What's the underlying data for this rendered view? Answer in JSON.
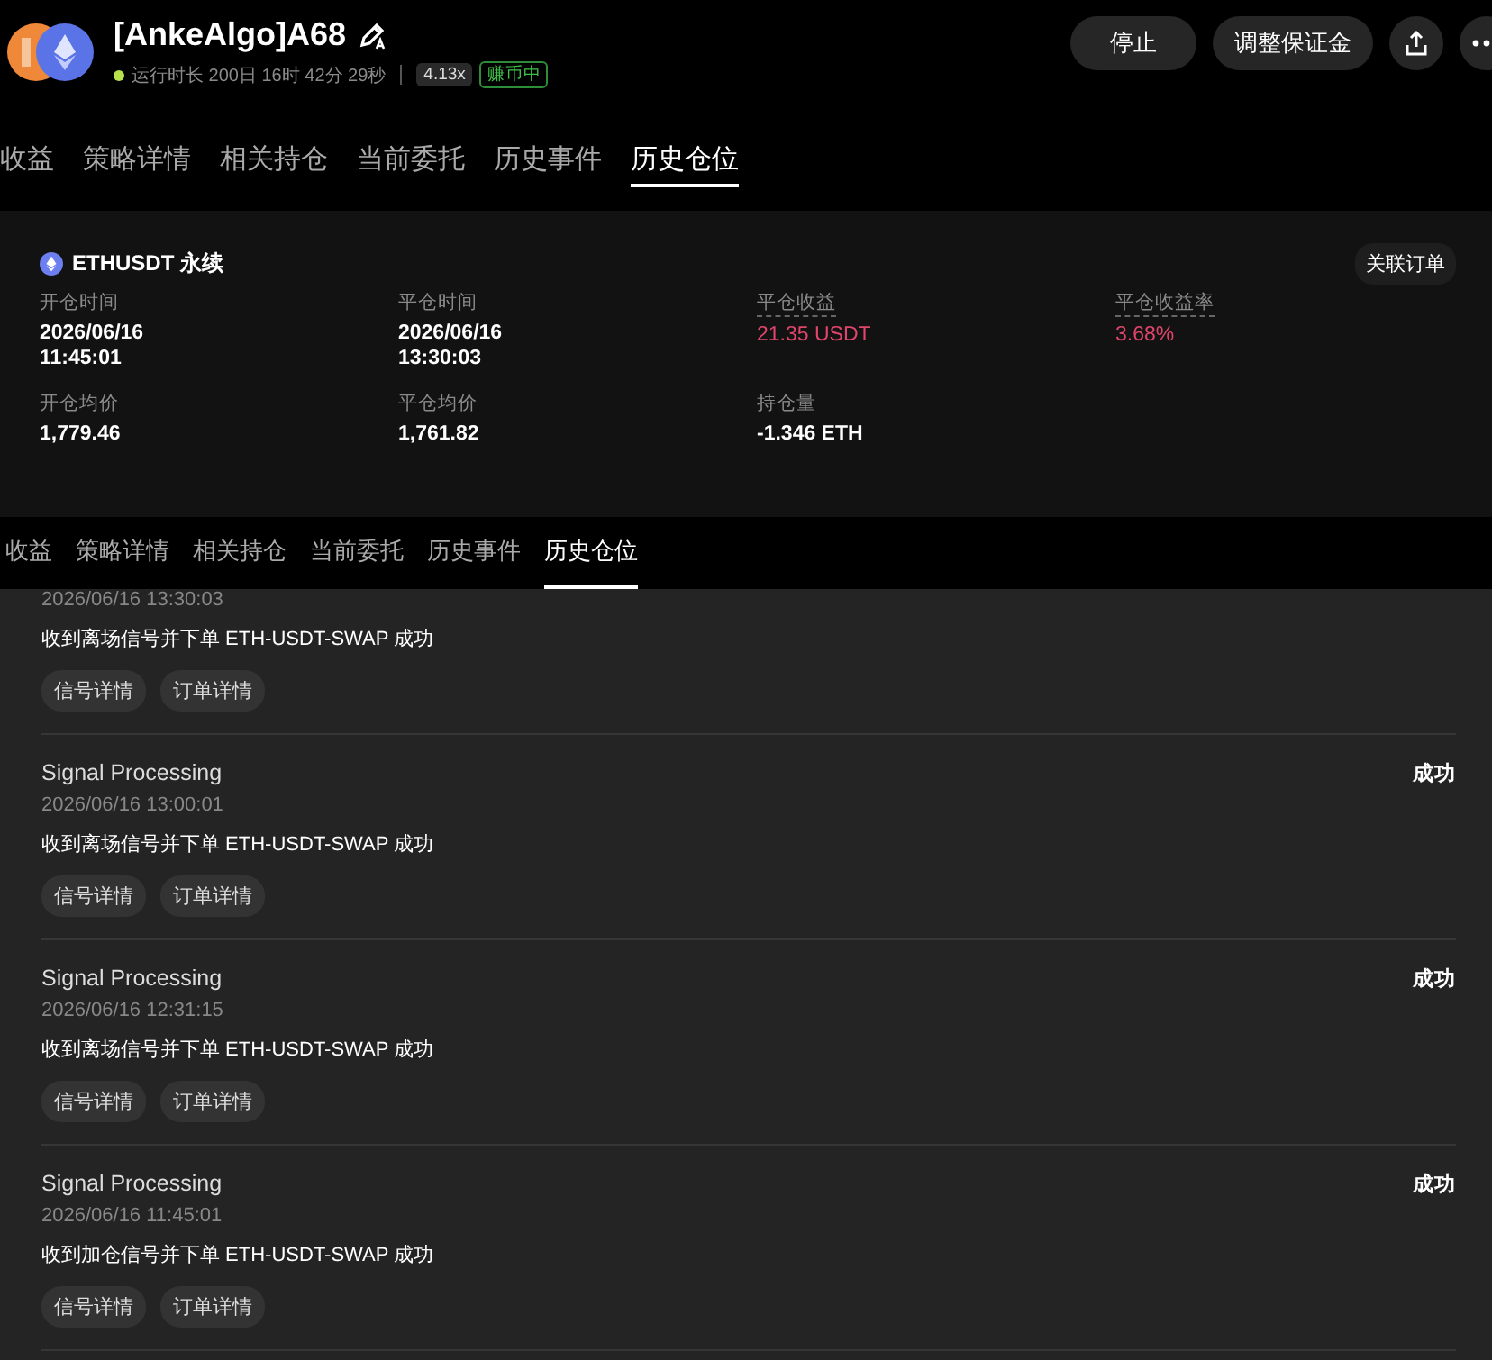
{
  "header": {
    "title": "[AnkeAlgo]A68",
    "runtime": "运行时长 200日 16时 42分 29秒",
    "leverage": "4.13x",
    "status_badge": "赚币中",
    "buttons": [
      "停止",
      "调整保证金"
    ]
  },
  "tabs": [
    {
      "label": "收益",
      "selected": false
    },
    {
      "label": "策略详情",
      "selected": false
    },
    {
      "label": "相关持仓",
      "selected": false
    },
    {
      "label": "当前委托",
      "selected": false
    },
    {
      "label": "历史事件",
      "selected": false
    },
    {
      "label": "历史仓位",
      "selected": true
    }
  ],
  "position": {
    "symbol": "ETHUSDT 永续",
    "link_button": "关联订单",
    "fields": [
      {
        "label": "开仓时间",
        "lines": [
          "2026/06/16",
          "11:45:01"
        ],
        "profit": false,
        "dotted": false
      },
      {
        "label": "平仓时间",
        "lines": [
          "2026/06/16",
          "13:30:03"
        ],
        "profit": false,
        "dotted": false
      },
      {
        "label": "平仓收益",
        "lines": [
          "21.35 USDT"
        ],
        "profit": true,
        "dotted": true
      },
      {
        "label": "平仓收益率",
        "lines": [
          "3.68%"
        ],
        "profit": true,
        "dotted": true
      },
      {
        "label": "开仓均价",
        "lines": [
          "1,779.46"
        ],
        "profit": false,
        "dotted": false
      },
      {
        "label": "平仓均价",
        "lines": [
          "1,761.82"
        ],
        "profit": false,
        "dotted": false
      },
      {
        "label": "持仓量",
        "lines": [
          "-1.346 ETH"
        ],
        "profit": false,
        "dotted": false
      }
    ]
  },
  "tabs_2": [
    {
      "label": "收益",
      "selected": false
    },
    {
      "label": "策略详情",
      "selected": false
    },
    {
      "label": "相关持仓",
      "selected": false
    },
    {
      "label": "当前委托",
      "selected": false
    },
    {
      "label": "历史事件",
      "selected": false
    },
    {
      "label": "历史仓位",
      "selected": true
    }
  ],
  "events": [
    {
      "time": "2026/06/16 13:30:03",
      "message": "收到离场信号并下单 ETH-USDT-SWAP 成功",
      "actions": [
        "信号详情",
        "订单详情"
      ]
    },
    {
      "title": "Signal Processing",
      "status": "成功",
      "time": "2026/06/16 13:00:01",
      "message": "收到离场信号并下单 ETH-USDT-SWAP 成功",
      "actions": [
        "信号详情",
        "订单详情"
      ]
    },
    {
      "title": "Signal Processing",
      "status": "成功",
      "time": "2026/06/16 12:31:15",
      "message": "收到离场信号并下单 ETH-USDT-SWAP 成功",
      "actions": [
        "信号详情",
        "订单详情"
      ]
    },
    {
      "title": "Signal Processing",
      "status": "成功",
      "time": "2026/06/16 11:45:01",
      "message": "收到加仓信号并下单 ETH-USDT-SWAP 成功",
      "actions": [
        "信号详情",
        "订单详情"
      ]
    }
  ]
}
